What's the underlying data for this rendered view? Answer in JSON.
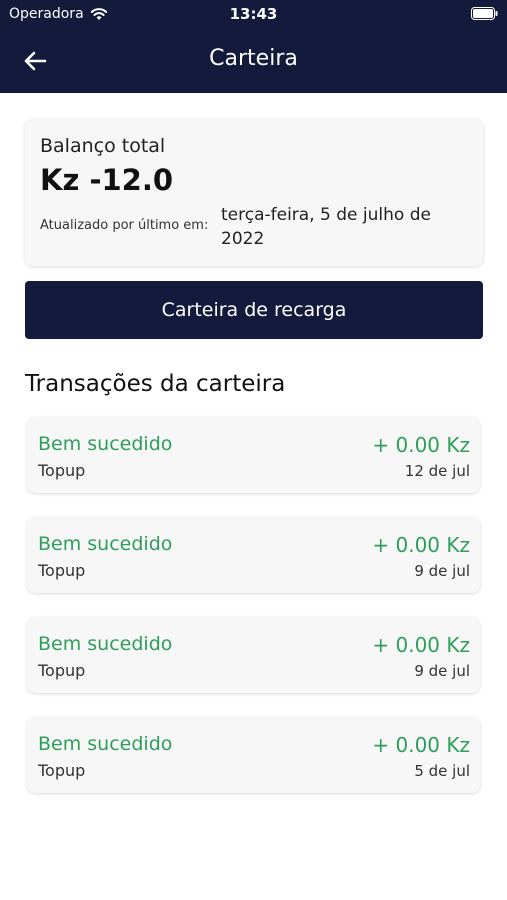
{
  "status_bar": {
    "carrier": "Operadora",
    "time": "13:43"
  },
  "header": {
    "title": "Carteira",
    "background": "#141a3c"
  },
  "balance": {
    "label": "Balanço total",
    "value": "Kz -12.0",
    "updated_label": "Atualizado por último em:",
    "updated_value": "terça-feira, 5 de julho de 2022"
  },
  "actions": {
    "recharge_label": "Carteira de recarga"
  },
  "transactions": {
    "title": "Transações da carteira",
    "accent_color": "#2e9e5b",
    "items": [
      {
        "status": "Bem sucedido",
        "type": "Topup",
        "amount": "+ 0.00 Kz",
        "date": "12 de jul"
      },
      {
        "status": "Bem sucedido",
        "type": "Topup",
        "amount": "+ 0.00 Kz",
        "date": "9 de jul"
      },
      {
        "status": "Bem sucedido",
        "type": "Topup",
        "amount": "+ 0.00 Kz",
        "date": "9 de jul"
      },
      {
        "status": "Bem sucedido",
        "type": "Topup",
        "amount": "+ 0.00 Kz",
        "date": "5 de jul"
      }
    ]
  }
}
